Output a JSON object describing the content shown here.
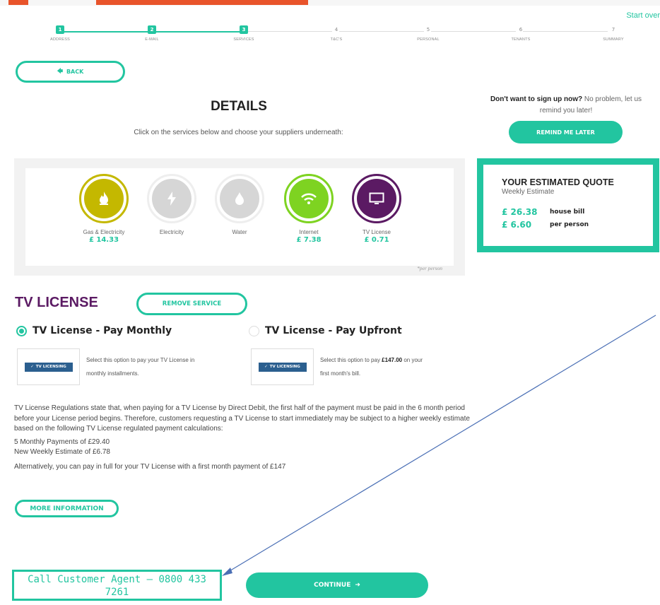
{
  "header": {
    "start_over": "Start over"
  },
  "steps": [
    {
      "num": "1",
      "label": "ADDRESS",
      "done": true
    },
    {
      "num": "2",
      "label": "E-MAIL",
      "done": true
    },
    {
      "num": "3",
      "label": "SERVICES",
      "done": true
    },
    {
      "num": "4",
      "label": "T&C'S",
      "done": false
    },
    {
      "num": "5",
      "label": "PERSONAL",
      "done": false
    },
    {
      "num": "6",
      "label": "TENANTS",
      "done": false
    },
    {
      "num": "7",
      "label": "SUMMARY",
      "done": false
    }
  ],
  "nav": {
    "back_label": "BACK"
  },
  "details": {
    "title": "DETAILS",
    "subtitle": "Click on the services below and choose your suppliers underneath:"
  },
  "remind": {
    "bold": "Don't want to sign up now?",
    "text": " No problem, let us remind you later!",
    "button": "REMIND ME LATER"
  },
  "services": [
    {
      "name": "Gas & Electricity",
      "price": "£ 14.33",
      "icon": "flame-icon",
      "color": "#c4b800"
    },
    {
      "name": "Electricity",
      "price": "",
      "icon": "lightning-icon",
      "color": "#d6d6d6"
    },
    {
      "name": "Water",
      "price": "",
      "icon": "water-drop-icon",
      "color": "#d6d6d6"
    },
    {
      "name": "Internet",
      "price": "£ 7.38",
      "icon": "wifi-icon",
      "color": "#7ed321"
    },
    {
      "name": "TV License",
      "price": "£ 0.71",
      "icon": "tv-icon",
      "color": "#5b1a63"
    }
  ],
  "per_person_note": "*per person",
  "quote": {
    "title": "YOUR ESTIMATED QUOTE",
    "subtitle": "Weekly Estimate",
    "house_amount": "£ 26.38",
    "house_label": "house bill",
    "person_amount": "£ 6.60",
    "person_label": "per person"
  },
  "tv_license": {
    "title": "TV LICENSE",
    "remove_button": "REMOVE SERVICE",
    "option_monthly": "TV License - Pay Monthly",
    "option_upfront": "TV License - Pay Upfront",
    "logo_text": "TV LICENSING",
    "monthly_desc_1": "Select this option to pay your TV License in",
    "monthly_desc_2": "monthly installments.",
    "upfront_desc_1a": "Select this option to pay ",
    "upfront_desc_amount": "£147.00",
    "upfront_desc_1b": " on your",
    "upfront_desc_2": "first month's bill.",
    "regulations": "TV License Regulations state that, when paying for a TV License by Direct Debit, the first half of the payment must be paid in the 6 month period before your License period begins. Therefore, customers requesting a TV License to start immediately may be subject to a higher weekly estimate based on the following TV License regulated payment calculations:",
    "calc_1": "5 Monthly Payments of £29.40",
    "calc_2": "New Weekly Estimate of £6.78",
    "alternative": "Alternatively, you can pay in full for your TV License with a first month payment of £147",
    "more_info": "MORE INFORMATION"
  },
  "footer": {
    "call_agent": "Call Customer Agent – 0800 433 7261",
    "continue": "CONTINUE"
  },
  "colors": {
    "accent": "#22c5a0",
    "brand_purple": "#5b1a63",
    "annotation_orange": "#e8542b"
  }
}
